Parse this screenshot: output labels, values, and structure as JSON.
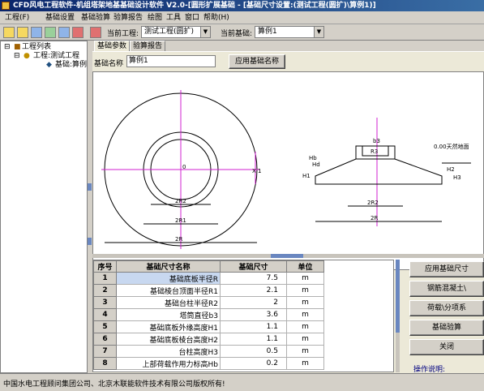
{
  "window": {
    "title": "CFD风电工程软件-机组塔架地基基础设计软件 V2.0-[圆形扩展基础 - [基础尺寸设置:(测试工程(圆扩)\\算例1)]"
  },
  "menu": [
    "工程(F)",
    "基础设置",
    "基础验算",
    "验算报告",
    "绘图",
    "工具",
    "窗口",
    "帮助(H)"
  ],
  "toolbar": {
    "project_label": "当前工程:",
    "project_value": "测试工程(圆扩)",
    "foundation_label": "当前基础:",
    "foundation_value": "算例1"
  },
  "tree": {
    "root": "工程列表",
    "project": "工程:测试工程",
    "foundation": "基础:算例"
  },
  "tabs": [
    "基础参数",
    "验算报告"
  ],
  "params": {
    "name_label": "基础名称",
    "name_value": "算例1",
    "apply_name_button": "应用基础名称"
  },
  "drawing": {
    "labels": {
      "o": "0",
      "x": "X",
      "x1": "1",
      "two_r2": "2R2",
      "two_r1": "2R1",
      "two_r": "2R",
      "b3": "b3",
      "r3": "R3",
      "two_r2_side": "2R2",
      "two_r_side": "2R",
      "ground": "0.00天然地面",
      "hb": "Hb",
      "h1": "H1",
      "h2": "H2",
      "h3": "H3",
      "hd": "Hd"
    }
  },
  "table": {
    "headers": [
      "序号",
      "基础尺寸名称",
      "基础尺寸",
      "单位"
    ],
    "rows": [
      {
        "no": "1",
        "name": "基础底板半径R",
        "value": "7.5",
        "unit": "m"
      },
      {
        "no": "2",
        "name": "基础棱台顶面半径R1",
        "value": "2.1",
        "unit": "m"
      },
      {
        "no": "3",
        "name": "基础台柱半径R2",
        "value": "2",
        "unit": "m"
      },
      {
        "no": "4",
        "name": "塔筒直径b3",
        "value": "3.6",
        "unit": "m"
      },
      {
        "no": "5",
        "name": "基础底板外缘高度H1",
        "value": "1.1",
        "unit": "m"
      },
      {
        "no": "6",
        "name": "基础底板棱台高度H2",
        "value": "1.1",
        "unit": "m"
      },
      {
        "no": "7",
        "name": "台柱高度H3",
        "value": "0.5",
        "unit": "m"
      },
      {
        "no": "8",
        "name": "上部荷载作用力标高Hb",
        "value": "0.2",
        "unit": "m"
      }
    ]
  },
  "side_buttons": [
    "应用基础尺寸",
    "钢筋混凝土\\",
    "荷载\\分项系",
    "基础验算",
    "关闭"
  ],
  "side_link": "操作说明:",
  "status": "中国水电工程顾问集团公司、北京木联能软件技术有限公司版权所有!",
  "colors": {
    "title_bar": "#0a246a",
    "drawing_axis": "#d020d0",
    "selected_cell": "#c8d8f0"
  }
}
